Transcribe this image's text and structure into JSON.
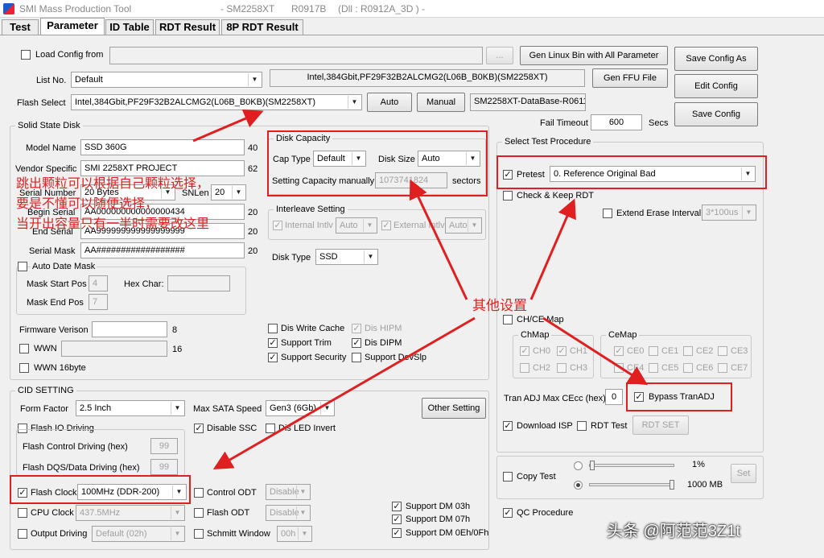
{
  "window": {
    "title": "SMI Mass Production Tool",
    "model": "- SM2258XT",
    "version": "R0917B",
    "dll": "(Dll : R0912A_3D ) -"
  },
  "tabs": [
    "Test",
    "Parameter",
    "ID Table",
    "RDT Result",
    "8P RDT Result"
  ],
  "top": {
    "load_config_label": "Load Config from",
    "load_config_value": "",
    "browse_label": "...",
    "gen_linux_label": "Gen Linux Bin with All Parameter",
    "list_no_label": "List No.",
    "list_no_value": "Default",
    "flash_info": "Intel,384Gbit,PF29F32B2ALCMG2(L06B_B0KB)(SM2258XT)",
    "gen_ffu_label": "Gen FFU File",
    "flash_select_label": "Flash Select",
    "flash_select_value": "Intel,384Gbit,PF29F32B2ALCMG2(L06B_B0KB)(SM2258XT)",
    "auto_label": "Auto",
    "manual_label": "Manual",
    "database_value": "SM2258XT-DataBase-R0611",
    "save_config_as_label": "Save Config As",
    "edit_config_label": "Edit Config",
    "save_config_label": "Save Config",
    "fail_timeout_label": "Fail Timeout",
    "fail_timeout_value": "600",
    "secs_label": "Secs"
  },
  "ssd": {
    "group_title": "Solid State Disk",
    "model_name_label": "Model Name",
    "model_name_value": "SSD 360G",
    "model_name_len": "40",
    "vendor_label": "Vendor Specific",
    "vendor_value": "SMI 2258XT PROJECT",
    "vendor_len": "62",
    "serial_number_label": "Serial Number",
    "serial_number_value": "20 Bytes",
    "snlen_label": "SNLen",
    "snlen_value": "20",
    "begin_serial_label": "Begin Serial",
    "begin_serial_value": "AA000000000000000434",
    "begin_serial_len": "20",
    "end_serial_label": "End Serial",
    "end_serial_value": "AA999999999999999999",
    "end_serial_len": "20",
    "serial_mask_label": "Serial Mask",
    "serial_mask_value": "AA##################",
    "serial_mask_len": "20",
    "auto_date_mask_label": "Auto Date Mask",
    "mask_start_label": "Mask Start Pos",
    "mask_start_value": "4",
    "hex_char_label": "Hex Char:",
    "hex_char_value": "",
    "mask_end_label": "Mask End Pos",
    "mask_end_value": "7",
    "firmware_label": "Firmware Verison",
    "firmware_value": "",
    "firmware_len": "8",
    "wwn_label": "WWN",
    "wwn_value": "",
    "wwn_len": "16",
    "wwn16_label": "WWN 16byte"
  },
  "disk_capacity": {
    "group_title": "Disk Capacity",
    "cap_type_label": "Cap Type",
    "cap_type_value": "Default",
    "disk_size_label": "Disk Size",
    "disk_size_value": "Auto",
    "manual_label": "Setting Capacity manually",
    "manual_value": "1073741824",
    "sectors_label": "sectors"
  },
  "interleave": {
    "group_title": "Interleave Setting",
    "internal_label": "Internal Intlv",
    "internal_value": "Auto",
    "external_label": "External Intlv",
    "external_value": "Auto"
  },
  "disk_type": {
    "label": "Disk Type",
    "value": "SSD"
  },
  "options": {
    "dis_write_cache": "Dis Write Cache",
    "support_trim": "Support Trim",
    "support_security": "Support Security",
    "dis_hipm": "Dis HIPM",
    "dis_dipm": "Dis DIPM",
    "support_devslp": "Support DevSlp"
  },
  "test_procedure": {
    "group_title": "Select Test Procedure",
    "pretest_label": "Pretest",
    "pretest_value": "0. Reference Original Bad",
    "check_keep_rdt_label": "Check & Keep RDT",
    "extend_erase_label": "Extend Erase Interval",
    "extend_erase_value": "3*100us"
  },
  "chce": {
    "map_label": "CH/CE Map",
    "chmap_title": "ChMap",
    "channels": [
      "CH0",
      "CH1",
      "CH2",
      "CH3"
    ],
    "cemap_title": "CeMap",
    "ces": [
      "CE0",
      "CE1",
      "CE2",
      "CE3",
      "CE4",
      "CE5",
      "CE6",
      "CE7"
    ],
    "tran_adj_label": "Tran ADJ Max CEcc (hex)",
    "tran_adj_value": "0",
    "bypass_label": "Bypass TranADJ",
    "download_isp_label": "Download ISP",
    "rdt_test_label": "RDT Test",
    "rdt_set_label": "RDT SET"
  },
  "copy_test": {
    "label": "Copy Test",
    "pct_value": "1%",
    "mb_value": "1000 MB",
    "set_label": "Set"
  },
  "qc": {
    "label": "QC Procedure"
  },
  "cid": {
    "group_title": "CID SETTING",
    "form_factor_label": "Form Factor",
    "form_factor_value": "2.5 Inch",
    "max_sata_label": "Max SATA Speed",
    "max_sata_value": "Gen3 (6Gb)",
    "other_setting_label": "Other Setting",
    "flash_io_label": "Flash IO Driving",
    "disable_ssc_label": "Disable SSC",
    "dis_led_label": "Dis LED Invert",
    "flash_ctrl_label": "Flash Control Driving (hex)",
    "flash_ctrl_value": "99",
    "flash_dqs_label": "Flash DQS/Data Driving (hex)",
    "flash_dqs_value": "99",
    "flash_clock_label": "Flash Clock",
    "flash_clock_value": "100MHz (DDR-200)",
    "control_odt_label": "Control ODT",
    "control_odt_value": "Disable",
    "cpu_clock_label": "CPU Clock",
    "cpu_clock_value": "437.5MHz",
    "flash_odt_label": "Flash ODT",
    "flash_odt_value": "Disable",
    "output_driving_label": "Output Driving",
    "output_driving_value": "Default (02h)",
    "schmitt_label": "Schmitt Window",
    "schmitt_value": "00h",
    "dm03_label": "Support DM 03h",
    "dm07_label": "Support DM 07h",
    "dm0e_label": "Support DM 0Eh/0Fh"
  },
  "annotations": {
    "note_line1": "跳出颗粒可以根据自己颗粒选择，",
    "note_line2": "要是不懂可以随便选择，",
    "note_line3": "当开出容量只有一半时需要改这里",
    "other_settings": "其他设置",
    "watermark": "头条 @阿范范3Z1t"
  },
  "colors": {
    "annotation": "#e02020"
  }
}
